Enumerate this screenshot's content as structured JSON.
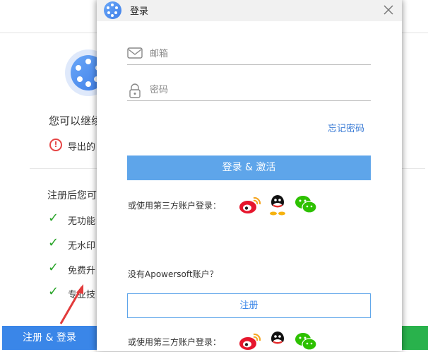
{
  "background_page": {
    "continue_text": "您可以继续",
    "warning_text": "导出的",
    "register_intro": "注册后您可",
    "benefits": [
      "无功能",
      "无水印",
      "免费升",
      "专业技"
    ],
    "register_login_button": "注册 & 登录"
  },
  "dialog": {
    "title": "登录",
    "email_placeholder": "邮箱",
    "password_placeholder": "密码",
    "forgot_password": "忘记密码",
    "login_button": "登录 & 激活",
    "third_party_label": "或使用第三方账户登录：",
    "no_account_text": "没有Apowersoft账户？",
    "register_button": "注册",
    "social_icons": [
      "weibo-icon",
      "qq-icon",
      "wechat-icon"
    ]
  },
  "colors": {
    "primary_blue": "#5ea5ea",
    "button_blue": "#3a86e8",
    "check_green": "#2aa52a",
    "warning_red": "#e64545"
  }
}
